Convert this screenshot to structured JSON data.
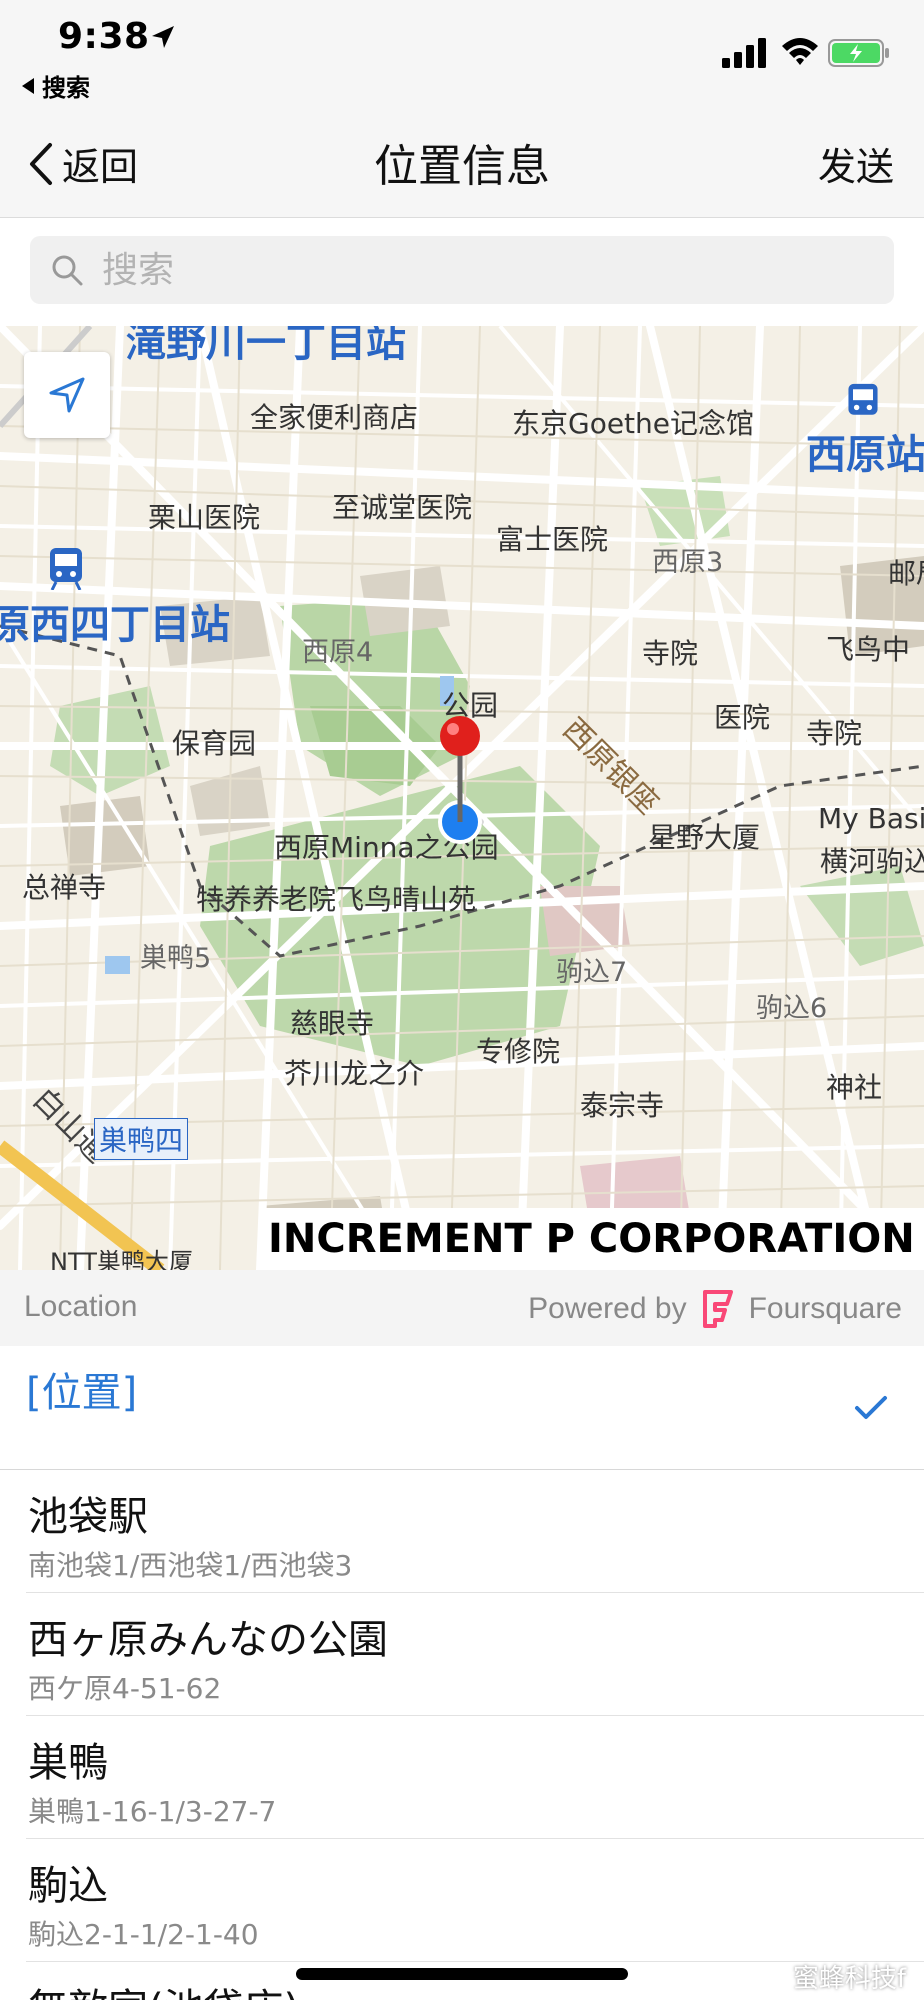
{
  "status_bar": {
    "time": "9:38",
    "back_app_label": "搜索"
  },
  "nav": {
    "back_label": "返回",
    "title": "位置信息",
    "send_label": "发送"
  },
  "search": {
    "placeholder": "搜索"
  },
  "map": {
    "labels": {
      "station_top": "滝野川一丁目站",
      "family_mart": "全家便利商店",
      "goethe": "东京Goethe记念馆",
      "nishihara_station": "西原站",
      "kuriyama": "栗山医院",
      "shiseido": "至诚堂医院",
      "fuji": "富士医院",
      "nishihara3": "西原3",
      "post": "邮局",
      "nishihara4chome_station": "原西四丁目站",
      "nishihara4": "西原4",
      "temple1": "寺院",
      "asuka": "飞鸟中",
      "park": "公园",
      "hoikuen": "保育园",
      "ginza": "西原银座",
      "hospital": "医院",
      "temple2": "寺院",
      "mybasic": "My Basic",
      "minna_park": "西原Minna之公园",
      "hoshino": "星野大厦",
      "yokokawa": "横河驹込",
      "sozenji": "总禅寺",
      "tokuyou": "特养养老院飞鸟晴山苑",
      "sugamo5": "巣鸭5",
      "komagome7": "驹込7",
      "komagome6": "驹込6",
      "jigenji": "慈眼寺",
      "senshuin": "专修院",
      "akutagawa": "芥川龙之介",
      "jinja": "神社",
      "taisoji": "泰宗寺",
      "hakusan": "白山通",
      "sugamo4": "巣鸭四",
      "ntt": "NTT巣鸭大厦"
    },
    "copyright": "INCREMENT P CORPORATION"
  },
  "location_header": {
    "left_label": "Location",
    "powered_by": "Powered by",
    "provider": "Foursquare"
  },
  "list": {
    "selected": {
      "title": "[位置]"
    },
    "items": [
      {
        "title": "池袋駅",
        "subtitle": "南池袋1/西池袋1/西池袋3"
      },
      {
        "title": "西ヶ原みんなの公園",
        "subtitle": "西ケ原4-51-62"
      },
      {
        "title": "巣鴨",
        "subtitle": "巣鴨1-16-1/3-27-7"
      },
      {
        "title": "駒込",
        "subtitle": "駒込2-1-1/2-1-40"
      }
    ],
    "partial_item": {
      "title": "無敵家(池袋店)"
    }
  },
  "watermark": "蜜蜂科技f",
  "colors": {
    "accent_blue": "#2a78d4",
    "map_bg": "#f4f0e6",
    "park_green": "#b9d6a6",
    "pin_red": "#e0201c",
    "battery_green": "#4cd964",
    "foursquare_pink": "#f94877"
  }
}
